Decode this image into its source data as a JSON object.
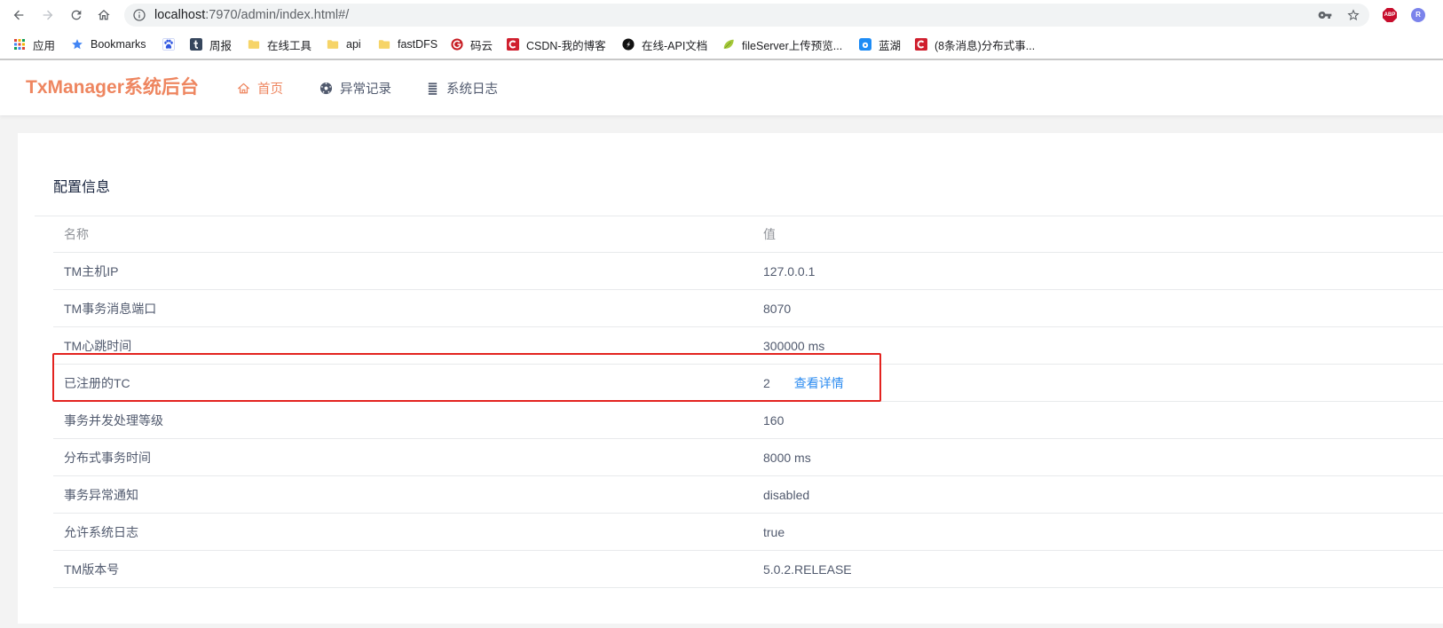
{
  "browser": {
    "nav": {
      "back_icon": "arrow-back-icon",
      "forward_icon": "arrow-forward-icon",
      "reload_icon": "reload-icon",
      "home_icon": "home-icon"
    },
    "omnibox": {
      "info_icon": "info-icon",
      "url_host": "localhost",
      "url_path": ":7970/admin/index.html#/",
      "key_icon": "key-icon",
      "bookmark_icon": "star-outline-icon"
    },
    "extensions": [
      {
        "label": "ABP",
        "icon": "adblock-plus-icon"
      },
      {
        "label": "R",
        "icon": "r-extension-icon"
      }
    ],
    "bookmarks": [
      {
        "label": "应用",
        "icon": "apps-grid-icon"
      },
      {
        "label": "Bookmarks",
        "icon": "star-icon"
      },
      {
        "icon": "baidu-paw-icon"
      },
      {
        "label": "周报",
        "icon": "tumblr-icon"
      },
      {
        "label": "在线工具",
        "icon": "folder-icon"
      },
      {
        "label": "api",
        "icon": "folder-icon"
      },
      {
        "label": "fastDFS",
        "icon": "folder-icon"
      },
      {
        "label": "码云",
        "icon": "gitee-icon"
      },
      {
        "label": "CSDN-我的博客",
        "icon": "csdn-icon"
      },
      {
        "label": "在线-API文档",
        "icon": "api-doc-icon"
      },
      {
        "label": "fileServer上传预览...",
        "icon": "leaf-icon"
      },
      {
        "label": "蓝湖",
        "icon": "lanhu-icon"
      },
      {
        "label": "(8条消息)分布式事...",
        "icon": "csdn-icon"
      }
    ]
  },
  "app": {
    "logo": "TxManager系统后台",
    "nav": [
      {
        "label": "首页",
        "icon": "home-outline-icon",
        "active": true
      },
      {
        "label": "异常记录",
        "icon": "exception-icon",
        "active": false
      },
      {
        "label": "系统日志",
        "icon": "list-icon",
        "active": false
      }
    ]
  },
  "config_card": {
    "title": "配置信息",
    "columns": [
      "名称",
      "值"
    ],
    "rows": [
      {
        "name": "TM主机IP",
        "value": "127.0.0.1"
      },
      {
        "name": "TM事务消息端口",
        "value": "8070"
      },
      {
        "name": "TM心跳时间",
        "value": "300000 ms"
      },
      {
        "name": "已注册的TC",
        "value": "2",
        "link": "查看详情"
      },
      {
        "name": "事务并发处理等级",
        "value": "160"
      },
      {
        "name": "分布式事务时间",
        "value": "8000 ms"
      },
      {
        "name": "事务异常通知",
        "value": "disabled"
      },
      {
        "name": "允许系统日志",
        "value": "true"
      },
      {
        "name": "TM版本号",
        "value": "5.0.2.RELEASE"
      }
    ]
  },
  "colors": {
    "brand": "#ee8660",
    "text": "#515a6e",
    "header_text": "#909399",
    "link": "#2d8cf0",
    "highlight_box": "#e3231f",
    "page_bg": "#f3f3f3"
  }
}
